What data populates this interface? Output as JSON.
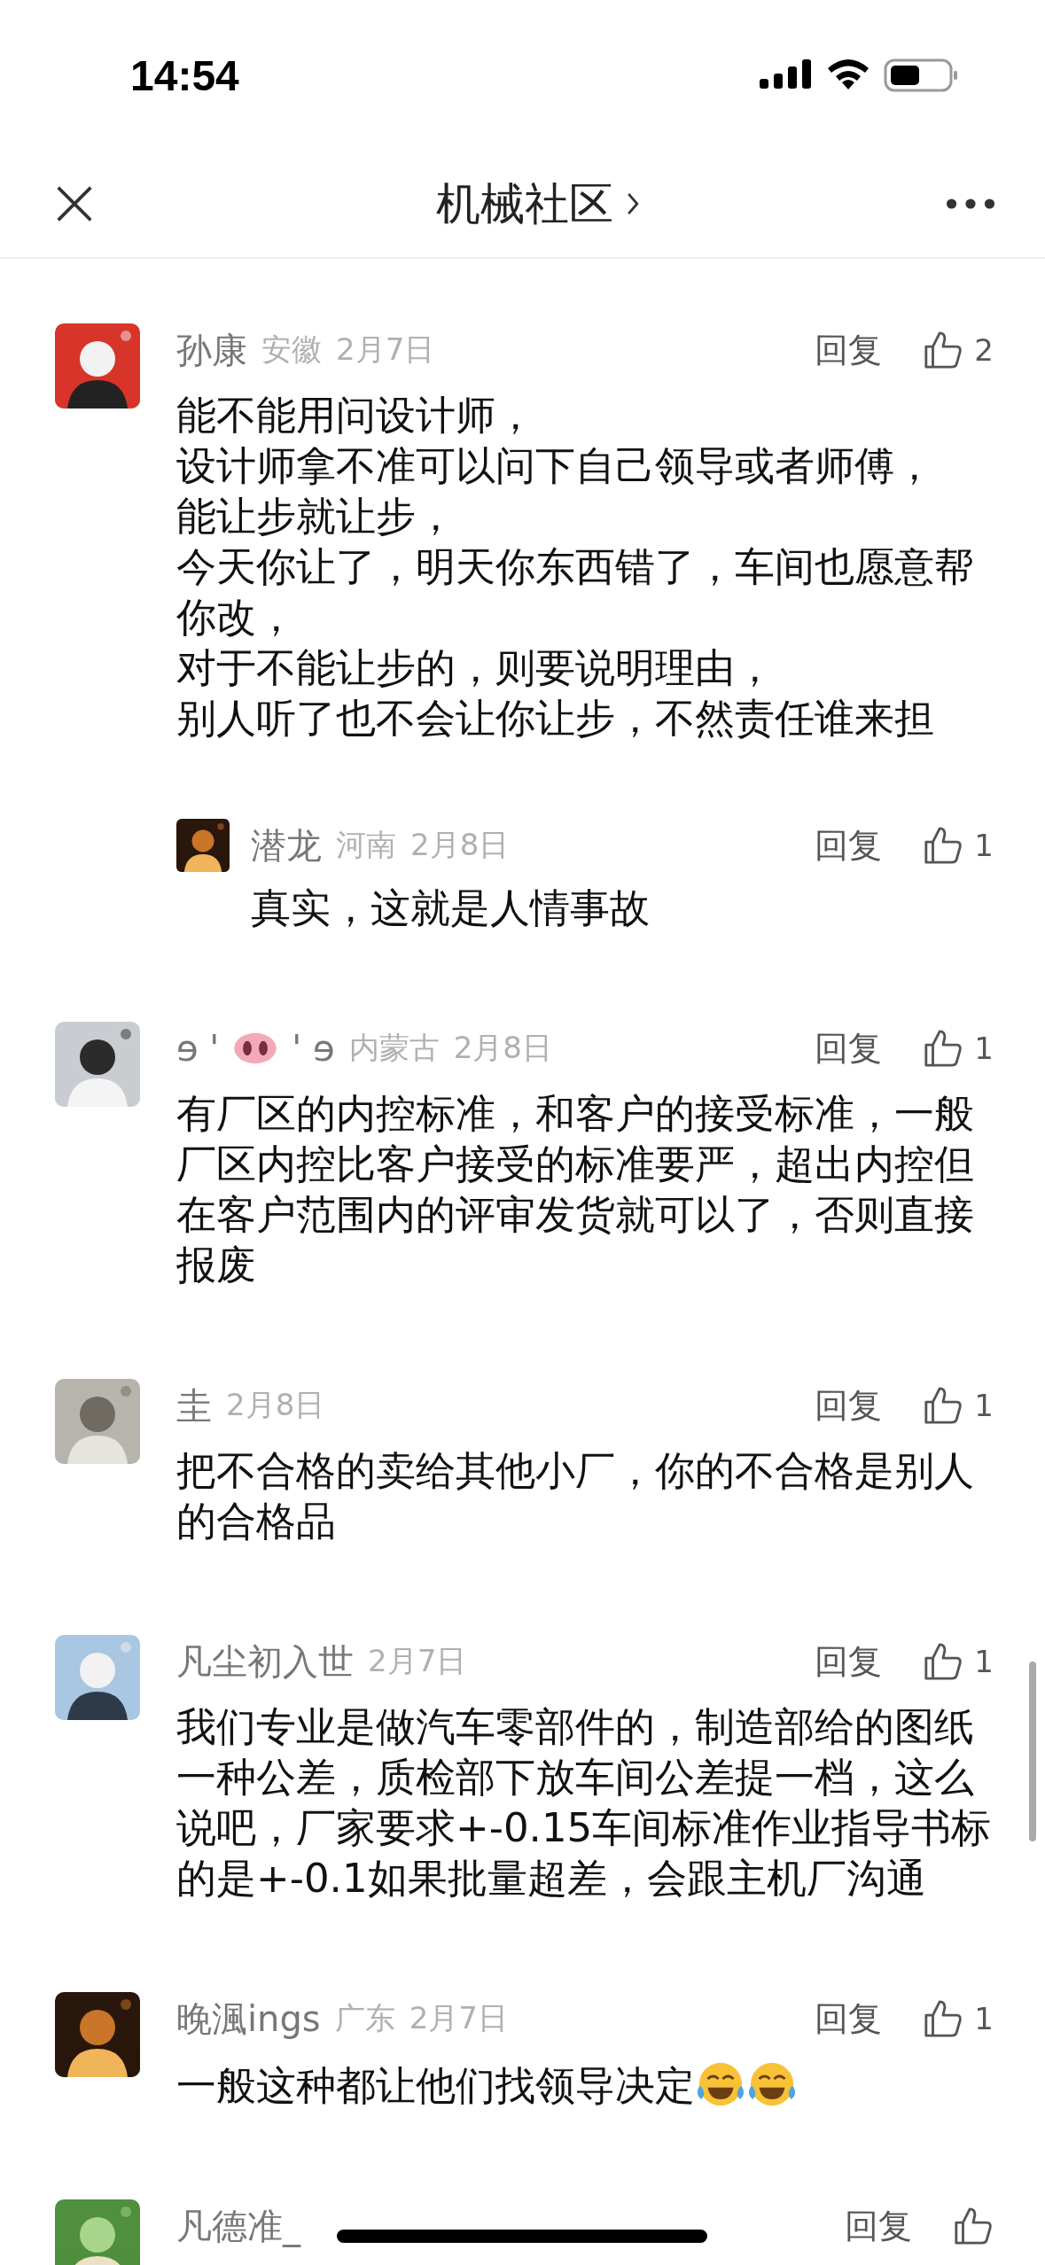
{
  "status_bar": {
    "time": "14:54"
  },
  "nav": {
    "title": "机械社区"
  },
  "comments": [
    {
      "name": [
        {
          "kind": "text",
          "text": "孙康"
        }
      ],
      "region": "安徽",
      "date": "2月7日",
      "reply_label": "回复",
      "likes": "2",
      "text": [
        {
          "kind": "line",
          "text": "能不能用问设计师，"
        },
        {
          "kind": "line",
          "text": "设计师拿不准可以问下自己领导或者师傅，"
        },
        {
          "kind": "line",
          "text": "能让步就让步，"
        },
        {
          "kind": "line",
          "text": "今天你让了，明天你东西错了，车间也愿意帮你改，"
        },
        {
          "kind": "line",
          "text": "对于不能让步的，则要说明理由，"
        },
        {
          "kind": "line",
          "text": "别人听了也不会让你让步，不然责任谁来担"
        }
      ],
      "replies": [
        {
          "name": [
            {
              "kind": "text",
              "text": "潜龙"
            }
          ],
          "region": "河南",
          "date": "2月8日",
          "reply_label": "回复",
          "likes": "1",
          "text": [
            {
              "kind": "text",
              "text": "真实，这就是人情事故"
            }
          ]
        }
      ]
    },
    {
      "name": [
        {
          "kind": "text",
          "text": "ɘ '"
        },
        {
          "kind": "pig_nose"
        },
        {
          "kind": "text",
          "text": "' ɘ"
        }
      ],
      "region": "内蒙古",
      "date": "2月8日",
      "reply_label": "回复",
      "likes": "1",
      "text": [
        {
          "kind": "text",
          "text": "有厂区的内控标准，和客户的接受标准，一般厂区内控比客户接受的标准要严，超出内控但在客户范围内的评审发货就可以了，否则直接报废"
        }
      ]
    },
    {
      "name": [
        {
          "kind": "text",
          "text": "圭"
        }
      ],
      "date": "2月8日",
      "reply_label": "回复",
      "likes": "1",
      "text": [
        {
          "kind": "text",
          "text": "把不合格的卖给其他小厂，你的不合格是别人的合格品"
        }
      ]
    },
    {
      "name": [
        {
          "kind": "text",
          "text": "凡尘初入世"
        }
      ],
      "date": "2月7日",
      "reply_label": "回复",
      "likes": "1",
      "text": [
        {
          "kind": "text",
          "text": "我们专业是做汽车零部件的，制造部给的图纸一种公差，质检部下放车间公差提一档，这么说吧，厂家要求+-0.15车间标准作业指导书标的是+-0.1如果批量超差，会跟主机厂沟通"
        }
      ]
    },
    {
      "name": [
        {
          "kind": "text",
          "text": "晚渢ings"
        }
      ],
      "region": "广东",
      "date": "2月7日",
      "reply_label": "回复",
      "likes": "1",
      "text": [
        {
          "kind": "text",
          "text": "一般这种都让他们找领导决定"
        },
        {
          "kind": "laugh"
        },
        {
          "kind": "laugh"
        }
      ]
    },
    {
      "name": [
        {
          "kind": "text",
          "text": "凡德准_"
        }
      ],
      "reply_label": "回复"
    }
  ]
}
